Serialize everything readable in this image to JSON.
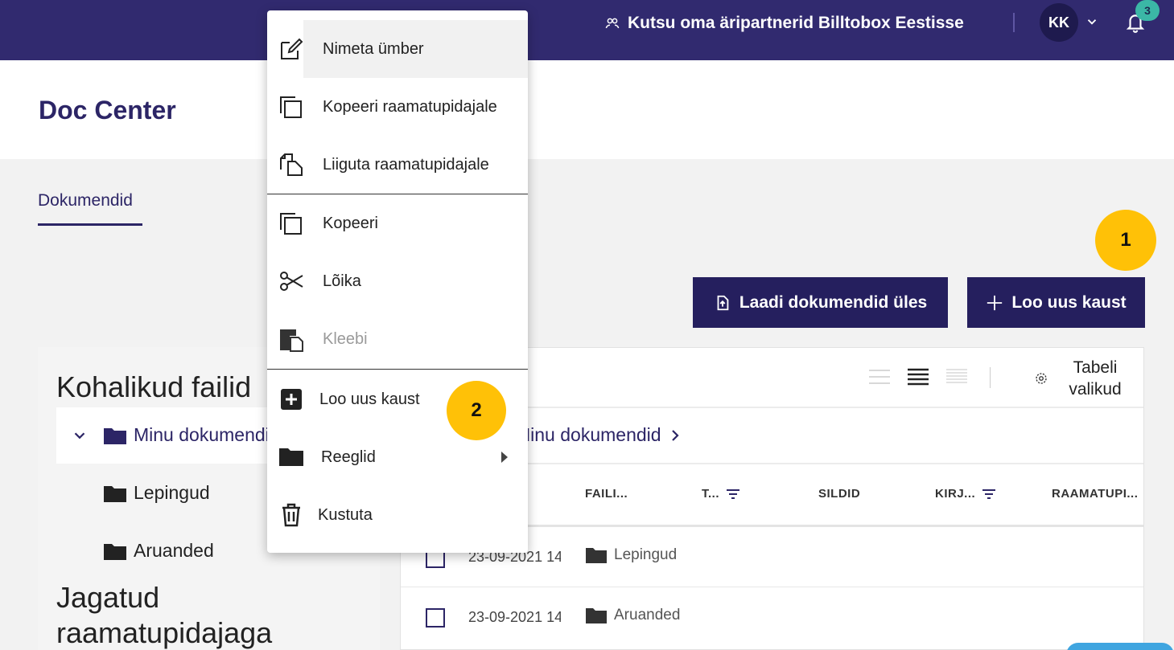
{
  "topbar": {
    "invite_text": "Kutsu oma äripartnerid Billtobox Eestisse",
    "avatar_initials": "KK",
    "notification_count": "3",
    "bg_color": "#312a6f",
    "badge_color": "#3bb7a6"
  },
  "header": {
    "title": "Doc Center"
  },
  "tabs": [
    {
      "label": "Dokumendid",
      "active": true
    }
  ],
  "actions": {
    "upload_label": "Laadi dokumendid üles",
    "new_folder_label": "Loo uus kaust"
  },
  "markers": {
    "one": "1",
    "two": "2",
    "color": "#ffc107"
  },
  "left_panel": {
    "local_title": "Kohalikud failid",
    "tree": [
      {
        "label": "Minu dokumendid",
        "expanded": true,
        "selected": true
      },
      {
        "label": "Lepingud"
      },
      {
        "label": "Aruanded"
      }
    ],
    "shared_title": "Jagatud raamatupidajaga"
  },
  "table": {
    "options_label": "Tabeli valikud",
    "breadcrumb": "Minu dokumendid",
    "columns": [
      {
        "label": "FAILI...",
        "filter": false
      },
      {
        "label": "T...",
        "filter": true
      },
      {
        "label": "SILDID",
        "filter": false
      },
      {
        "label": "KIRJ...",
        "filter": true
      },
      {
        "label": "RAAMATUPI...",
        "filter": false
      }
    ],
    "rows": [
      {
        "date": "23-09-2021 14",
        "name": "Lepingud"
      },
      {
        "date": "23-09-2021 14",
        "name": "Aruanded"
      }
    ]
  },
  "context_menu": {
    "items": [
      {
        "label": "Nimeta ümber",
        "icon": "edit-icon",
        "hovered": true
      },
      {
        "label": "Kopeeri raamatupidajale",
        "icon": "copy-icon"
      },
      {
        "label": "Liiguta raamatupidajale",
        "icon": "move-icon"
      },
      {
        "label": "Kopeeri",
        "icon": "copy-icon"
      },
      {
        "label": "Lõika",
        "icon": "scissors-icon"
      },
      {
        "label": "Kleebi",
        "icon": "paste-icon",
        "disabled": true
      },
      {
        "label": "Loo uus kaust",
        "icon": "add-box-icon"
      },
      {
        "label": "Reeglid",
        "icon": "folder-icon",
        "submenu": true
      },
      {
        "label": "Kustuta",
        "icon": "trash-icon"
      }
    ]
  },
  "colors": {
    "primary": "#251f5e",
    "accent_text": "#2c2566"
  }
}
